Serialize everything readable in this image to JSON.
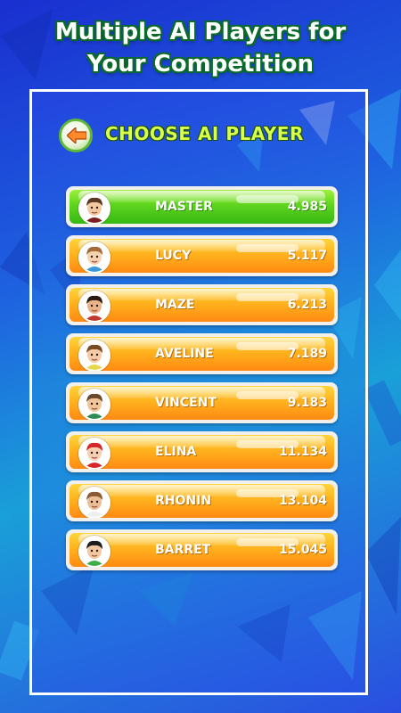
{
  "promo": {
    "line1": "Multiple AI Players for",
    "line2": "Your Competition"
  },
  "header": {
    "title": "CHOOSE AI PLAYER",
    "back_icon": "back-arrow-icon"
  },
  "colors": {
    "active_row": "#5fd41e",
    "inactive_row": "#ffb21e",
    "header_text": "#d8ff4a"
  },
  "players": [
    {
      "name": "MASTER",
      "score": "4.985",
      "active": true,
      "avatar": {
        "skin": "#f3c9a0",
        "hair": "#5a3a22",
        "shirt": "#7a1f1f"
      }
    },
    {
      "name": "LUCY",
      "score": "5.117",
      "active": false,
      "avatar": {
        "skin": "#f6d2b0",
        "hair": "#a56a3a",
        "shirt": "#3a9ad8"
      }
    },
    {
      "name": "MAZE",
      "score": "6.213",
      "active": false,
      "avatar": {
        "skin": "#e9b38a",
        "hair": "#2a1a12",
        "shirt": "#c0392b"
      }
    },
    {
      "name": "AVELINE",
      "score": "7.189",
      "active": false,
      "avatar": {
        "skin": "#f4cba6",
        "hair": "#7a4a22",
        "shirt": "#e6d84a"
      }
    },
    {
      "name": "VINCENT",
      "score": "9.183",
      "active": false,
      "avatar": {
        "skin": "#f1c59a",
        "hair": "#6a4a2a",
        "shirt": "#2e8b57"
      }
    },
    {
      "name": "ELINA",
      "score": "11.134",
      "active": false,
      "avatar": {
        "skin": "#f6d0b2",
        "hair": "#d62828",
        "shirt": "#d62828"
      }
    },
    {
      "name": "RHONIN",
      "score": "13.104",
      "active": false,
      "avatar": {
        "skin": "#eabf98",
        "hair": "#8a5a34",
        "shirt": "#eeeeee"
      }
    },
    {
      "name": "BARRET",
      "score": "15.045",
      "active": false,
      "avatar": {
        "skin": "#f2c8a0",
        "hair": "#1e1e1e",
        "shirt": "#3fae49"
      }
    }
  ]
}
